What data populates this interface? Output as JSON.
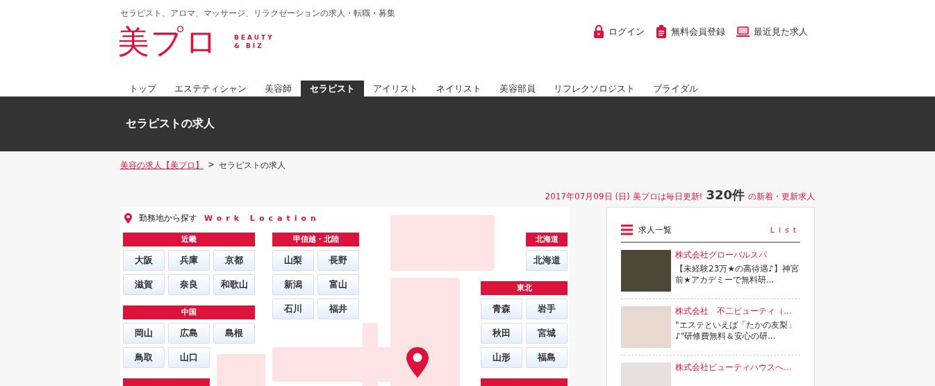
{
  "header": {
    "tagline": "セラピスト、アロマ、マッサージ、リラクゼーションの求人・転職・募集",
    "logo": {
      "mark": "美プロ",
      "sub_1": "BEAUTY",
      "sub_2": "& BIZ"
    },
    "links": [
      {
        "kind": "lock",
        "label": "ログイン"
      },
      {
        "kind": "clipboard",
        "label": "無料会員登録"
      },
      {
        "kind": "laptop",
        "label": "最近見た求人"
      }
    ]
  },
  "tabs": [
    {
      "label": "トップ",
      "selected": false
    },
    {
      "label": "エステティシャン",
      "selected": false
    },
    {
      "label": "美容師",
      "selected": false
    },
    {
      "label": "セラピスト",
      "selected": true
    },
    {
      "label": "アイリスト",
      "selected": false
    },
    {
      "label": "ネイリスト",
      "selected": false
    },
    {
      "label": "美容部員",
      "selected": false
    },
    {
      "label": "リフレクソロジスト",
      "selected": false
    },
    {
      "label": "ブライダル",
      "selected": false
    }
  ],
  "page_title": "セラピストの求人",
  "breadcrumbs": [
    {
      "label": "美容の求人【美プロ】",
      "link": true
    },
    {
      "label": "セラピストの求人",
      "link": false
    }
  ],
  "breadcrumb_separator": ">",
  "update": {
    "date": "2017年07月09日 (日) 美プロは毎日更新!",
    "count": "320件",
    "suffix": "の新着・更新求人"
  },
  "map": {
    "title": "勤務地から探す",
    "subtitle": "Work Location",
    "regions": [
      {
        "name": "近畿",
        "prefectures": [
          "大阪",
          "兵庫",
          "京都",
          "滋賀",
          "奈良",
          "和歌山"
        ]
      },
      {
        "name": "中国",
        "prefectures": [
          "岡山",
          "広島",
          "島根",
          "鳥取",
          "山口"
        ]
      },
      {
        "name": "甲信越・北陸",
        "prefectures": [
          "山梨",
          "長野",
          "新潟",
          "富山",
          "石川",
          "福井"
        ]
      },
      {
        "name": "北海道",
        "prefectures": [
          "北海道"
        ]
      },
      {
        "name": "東北",
        "prefectures": [
          "青森",
          "岩手",
          "秋田",
          "宮城",
          "山形",
          "福島"
        ]
      }
    ]
  },
  "job_list": {
    "title": "求人一覧",
    "subtitle": "List",
    "items": [
      {
        "company": "株式会社グローバルスパ",
        "text": "【未経験23万★の高待遇♪】神宮前★アカデミーで無料研..."
      },
      {
        "company": "株式会社　不二ビューティ（…",
        "text": "\"エステといえば「たかの友梨」♪\"研修費無料＆安心の研..."
      },
      {
        "company": "株式会社ビューティハウスへ…"
      }
    ]
  }
}
